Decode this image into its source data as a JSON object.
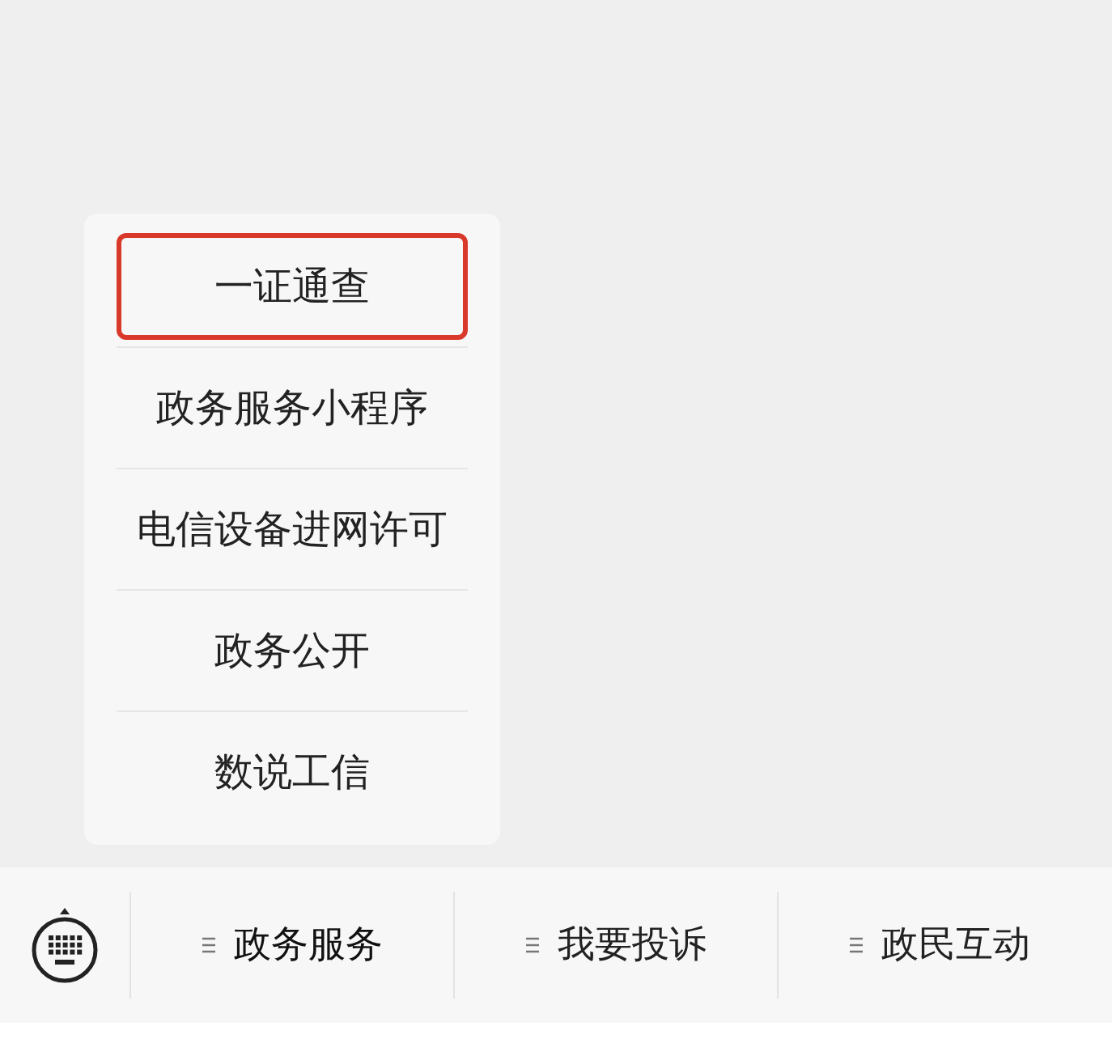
{
  "submenu": {
    "items": [
      {
        "label": "一证通查",
        "highlighted": true
      },
      {
        "label": "政务服务小程序",
        "highlighted": false
      },
      {
        "label": "电信设备进网许可",
        "highlighted": false
      },
      {
        "label": "政务公开",
        "highlighted": false
      },
      {
        "label": "数说工信",
        "highlighted": false
      }
    ]
  },
  "menu_bar": {
    "items": [
      {
        "label": "政务服务",
        "selected": true
      },
      {
        "label": "我要投诉",
        "selected": false
      },
      {
        "label": "政民互动",
        "selected": false
      }
    ]
  }
}
